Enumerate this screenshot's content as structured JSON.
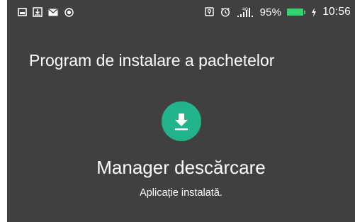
{
  "status_bar": {
    "battery_percent": "95%",
    "battery_level": 0.95,
    "network_type": "4G",
    "time": "10:56"
  },
  "header": {
    "title": "Program de instalare a pachetelor"
  },
  "app": {
    "name": "Manager descărcare",
    "status": "Aplicație instalată.",
    "icon": "download-icon",
    "icon_color": "#21b38a"
  },
  "colors": {
    "background": "#404040",
    "battery": "#31d36d"
  }
}
